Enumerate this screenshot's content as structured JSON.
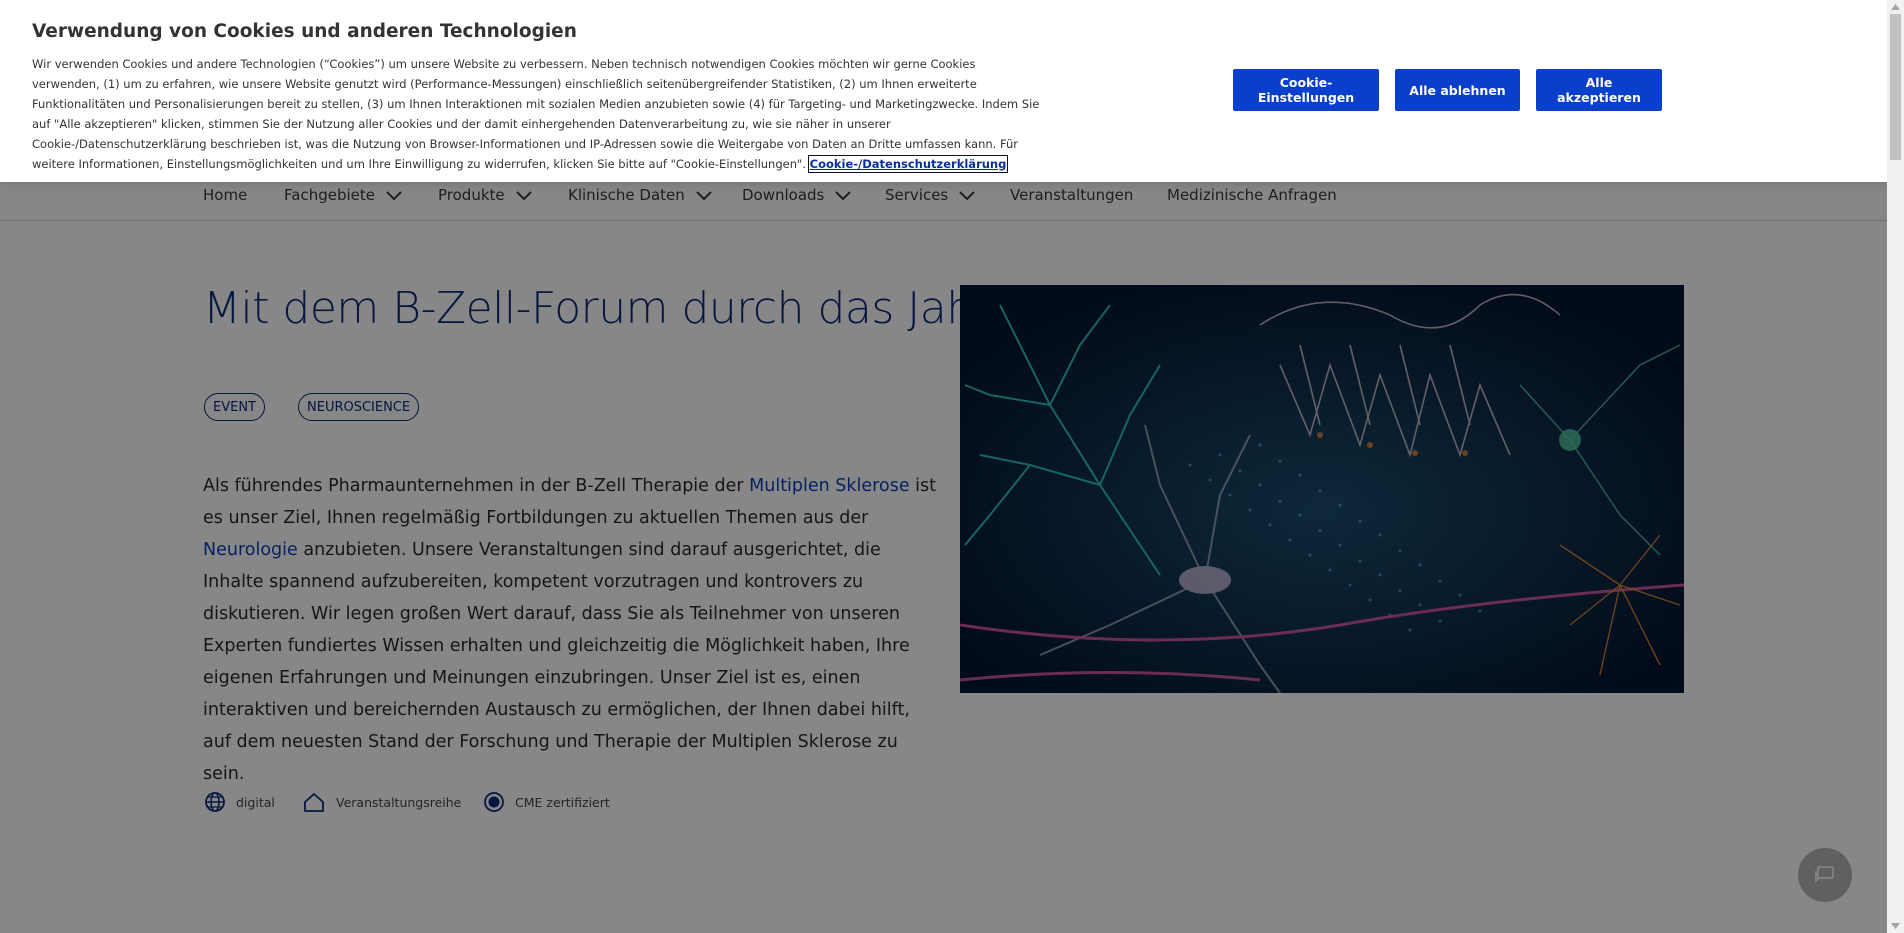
{
  "nav": {
    "items": [
      {
        "label": "Home",
        "dropdown": false
      },
      {
        "label": "Fachgebiete",
        "dropdown": true
      },
      {
        "label": "Produkte",
        "dropdown": true
      },
      {
        "label": "Klinische Daten",
        "dropdown": true
      },
      {
        "label": "Downloads",
        "dropdown": true
      },
      {
        "label": "Services",
        "dropdown": true
      },
      {
        "label": "Veranstaltungen",
        "dropdown": false
      },
      {
        "label": "Medizinische Anfragen",
        "dropdown": false
      }
    ]
  },
  "article": {
    "title": "Mit dem B-Zell-Forum durch das Jahr",
    "tags": [
      "EVENT",
      "NEUROSCIENCE"
    ],
    "body": {
      "p1": "Als führendes Pharmaunternehmen in der B-Zell Therapie der ",
      "link1": "Multiplen Sklerose",
      "p2": " ist es unser Ziel, Ihnen regelmäßig Fortbildungen zu aktuellen Themen aus der ",
      "link2": "Neurologie",
      "p3": " anzubieten. Unsere Veranstaltungen sind darauf ausgerichtet, die Inhalte spannend aufzubereiten, kompetent vorzutragen und kontrovers zu diskutieren. Wir legen großen Wert darauf, dass Sie als Teilnehmer von unseren Experten fundiertes Wissen erhalten und gleichzeitig die Möglichkeit haben, Ihre eigenen Erfahrungen und Meinungen einzubringen. Unser Ziel ist es, einen interaktiven und bereichernden Austausch zu ermöglichen, der Ihnen dabei hilft, auf dem neuesten Stand der Forschung und Therapie der Multiplen Sklerose zu sein."
    },
    "meta": [
      {
        "icon": "globe-icon",
        "label": "digital"
      },
      {
        "icon": "house-icon",
        "label": "Veranstaltungsreihe"
      },
      {
        "icon": "radio-circle-icon",
        "label": "CME zertifiziert"
      }
    ]
  },
  "cookie_banner": {
    "title": "Verwendung von Cookies und anderen Technologien",
    "text": "Wir verwenden Cookies und andere Technologien (“Cookies”) um unsere Website zu verbessern. Neben technisch notwendigen Cookies möchten wir gerne Cookies verwenden, (1) um zu erfahren, wie unsere Website genutzt wird (Performance-Messungen) einschließlich seitenübergreifender Statistiken, (2) um Ihnen erweiterte Funktionalitäten und Personalisierungen bereit zu stellen, (3) um Ihnen Interaktionen mit sozialen Medien anzubieten sowie (4) für Targeting- und Marketingzwecke. Indem Sie auf \"Alle akzeptieren\" klicken, stimmen Sie der Nutzung aller Cookies und der damit einhergehenden Datenverarbeitung zu, wie sie näher in unserer Cookie-/Datenschutzerklärung beschrieben ist, was die Nutzung von Browser-Informationen und IP-Adressen sowie die Weitergabe von Daten an Dritte umfassen kann. Für weitere Informationen, Einstellungsmöglichkeiten und um Ihre Einwilligung zu widerrufen, klicken Sie bitte auf \"Cookie-Einstellungen\". ",
    "link": "Cookie-/Datenschutzerklärung",
    "buttons": {
      "settings": "Cookie-Einstellungen",
      "reject": "Alle ablehnen",
      "accept": "Alle akzeptieren"
    }
  },
  "colors": {
    "brand_blue": "#0a3fcc",
    "title_blue": "#0a2a7a",
    "link_blue": "#0a3fb5"
  }
}
